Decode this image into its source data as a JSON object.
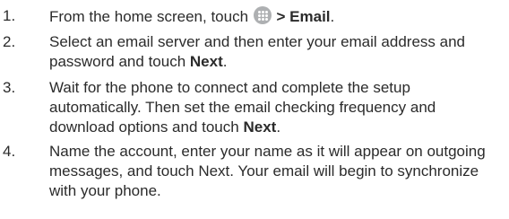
{
  "steps": [
    {
      "number": "1.",
      "before_icon": "From the home screen, touch",
      "icon": "apps-grid-icon",
      "after_icon": "> Email",
      "end": "."
    },
    {
      "number": "2.",
      "text": "Select an email server and then enter your email address and password and touch",
      "bold": "Next",
      "end": "."
    },
    {
      "number": "3.",
      "text": "Wait for the phone to connect and complete the setup automatically. Then set the email checking frequency and download options and touch",
      "bold": "Next",
      "end": "."
    },
    {
      "number": "4.",
      "text": "Name the account, enter your name as it will appear on outgoing messages, and touch Next. Your email will begin to synchronize with your phone."
    }
  ]
}
